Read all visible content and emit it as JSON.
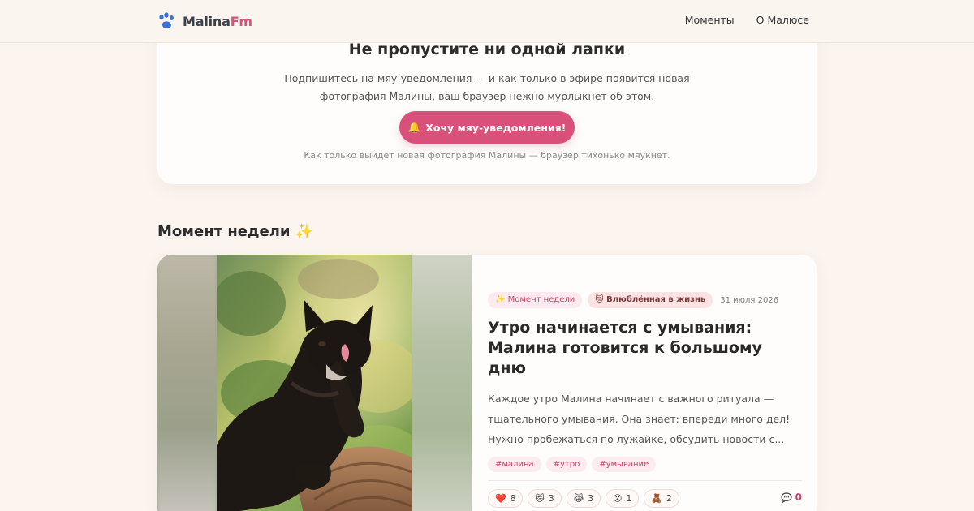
{
  "header": {
    "logo_main": "Malina",
    "logo_accent": "Fm",
    "nav": [
      {
        "label": "Моменты"
      },
      {
        "label": "О Малюсе"
      }
    ]
  },
  "subscribe": {
    "title": "Не пропустите ни одной лапки",
    "description": "Подпишитесь на мяу-уведомления — и как только в эфире появится новая фотография Малины, ваш браузер нежно мурлыкнет об этом.",
    "button_icon": "🔔",
    "button_label": "Хочу мяу-уведомления!",
    "note": "Как только выйдет новая фотография Малины — браузер тихонько мяукнет."
  },
  "section": {
    "title": "Момент недели",
    "title_emoji": "✨"
  },
  "moment": {
    "badge": "✨ Момент недели",
    "mood": "😻 Влюблённая в жизнь",
    "date": "31 июля 2026",
    "title": "Утро начинается с умывания: Малина готовится к большому дню",
    "excerpt": "Каждое утро Малина начинает с важного ритуала — тщательного умывания. Она знает: впереди много дел! Нужно пробежаться по лужайке, обсудить новости с...",
    "tags": [
      "#малина",
      "#утро",
      "#умывание"
    ],
    "reactions": [
      {
        "emoji": "❤️",
        "count": "8",
        "icon": "heart-icon"
      },
      {
        "emoji": "😻",
        "count": "3",
        "icon": "cat-heart-eyes-icon"
      },
      {
        "emoji": "😹",
        "count": "3",
        "icon": "cat-laugh-icon"
      },
      {
        "emoji": "😮",
        "count": "1",
        "icon": "surprised-icon"
      },
      {
        "emoji": "🧸",
        "count": "2",
        "icon": "teddy-bear-icon"
      }
    ],
    "comments_count": "0"
  },
  "colors": {
    "accent": "#d9507a",
    "background": "#fbf4ef",
    "card": "#fefdfb"
  }
}
